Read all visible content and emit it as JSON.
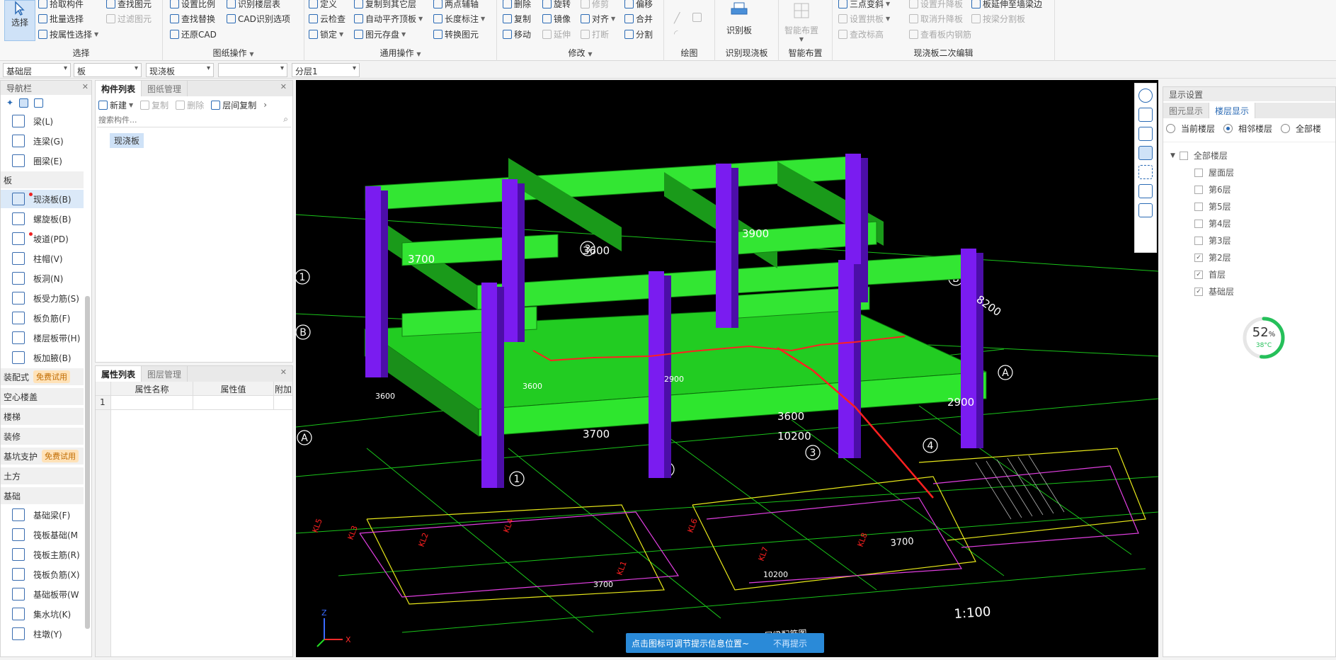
{
  "ribbon": {
    "select": {
      "label": "选择",
      "items": [
        "拾取构件",
        "批量选择",
        "按属性选择"
      ],
      "items2": [
        "查找图元",
        "过滤图元"
      ],
      "title": "选择"
    },
    "drawing_ops": {
      "items": [
        "设置比例",
        "查找替换",
        "还原CAD"
      ],
      "items2": [
        "识别楼层表",
        "CAD识别选项"
      ],
      "title": "图纸操作"
    },
    "general_ops": {
      "col1": [
        "定义",
        "云检查",
        "锁定"
      ],
      "col2": [
        "复制到其它层",
        "自动平齐顶板",
        "图元存盘"
      ],
      "col3": [
        "两点辅轴",
        "长度标注",
        "转换图元"
      ],
      "title": "通用操作"
    },
    "modify": {
      "col1": [
        "删除",
        "复制",
        "移动"
      ],
      "col2": [
        "旋转",
        "镜像",
        "延伸"
      ],
      "col3": [
        "修剪",
        "对齐",
        "打断"
      ],
      "col4": [
        "偏移",
        "合并",
        "分割"
      ],
      "title": "修改"
    },
    "draw": {
      "title": "绘图"
    },
    "identify_slab": {
      "label": "识别板",
      "title": "识别现浇板"
    },
    "smart_layout": {
      "label": "智能布置",
      "title": "智能布置"
    },
    "slab_edit": {
      "col1": [
        "三点变斜",
        "设置拱板",
        "查改标高"
      ],
      "col2": [
        "设置升降板",
        "取消升降板",
        "查看板内钢筋"
      ],
      "col3": [
        "板延伸至墙梁边",
        "按梁分割板"
      ],
      "title": "现浇板二次编辑"
    }
  },
  "dropbar": {
    "floor": "基础层",
    "type": "板",
    "component": "现浇板",
    "blank": "",
    "layer": "分层1"
  },
  "nav": {
    "title": "导航栏",
    "items_top": [
      {
        "label": "梁(L)"
      },
      {
        "label": "连梁(G)"
      },
      {
        "label": "圈梁(E)"
      }
    ],
    "cat_slab": "板",
    "slab_items": [
      {
        "label": "现浇板(B)"
      },
      {
        "label": "螺旋板(B)"
      },
      {
        "label": "坡道(PD)"
      },
      {
        "label": "柱帽(V)"
      },
      {
        "label": "板洞(N)"
      },
      {
        "label": "板受力筋(S)"
      },
      {
        "label": "板负筋(F)"
      },
      {
        "label": "楼层板带(H)"
      },
      {
        "label": "板加腋(B)"
      }
    ],
    "cat_prefab": "装配式",
    "free_trial": "免费试用",
    "cat_hollow": "空心楼盖",
    "cat_stairs": "楼梯",
    "cat_decor": "装修",
    "cat_pit": "基坑支护",
    "cat_earth": "土方",
    "cat_found": "基础",
    "found_items": [
      {
        "label": "基础梁(F)"
      },
      {
        "label": "筏板基础(M"
      },
      {
        "label": "筏板主筋(R)"
      },
      {
        "label": "筏板负筋(X)"
      },
      {
        "label": "基础板带(W"
      },
      {
        "label": "集水坑(K)"
      },
      {
        "label": "柱墩(Y)"
      }
    ]
  },
  "component_list": {
    "tab1": "构件列表",
    "tab2": "图纸管理",
    "new": "新建",
    "copy": "复制",
    "delete": "删除",
    "floor_copy": "层间复制",
    "search_placeholder": "搜索构件...",
    "item": "现浇板"
  },
  "property_list": {
    "tab1": "属性列表",
    "tab2": "图层管理",
    "col_name": "属性名称",
    "col_value": "属性值",
    "col_extra": "附加",
    "row1": "1"
  },
  "viewport": {
    "labels": [
      "3700",
      "3600",
      "3900",
      "3600",
      "2900",
      "3700",
      "8200",
      "2900",
      "3600",
      "10200",
      "3700",
      "3600",
      "10200",
      "3700"
    ],
    "axis": [
      "1",
      "B",
      "3",
      "B",
      "A",
      "A",
      "4",
      "2",
      "1",
      "3"
    ],
    "scale": "1:100",
    "plan_title": "二层梁配筋图"
  },
  "tip": {
    "text": "点击图标可调节提示信息位置~",
    "dismiss": "不再提示"
  },
  "display": {
    "title": "显示设置",
    "tab1": "图元显示",
    "tab2": "楼层显示",
    "radio_current": "当前楼层",
    "radio_adjacent": "相邻楼层",
    "radio_all": "全部楼",
    "floors_root": "全部楼层",
    "floors": [
      {
        "label": "屋面层",
        "checked": false
      },
      {
        "label": "第6层",
        "checked": false
      },
      {
        "label": "第5层",
        "checked": false
      },
      {
        "label": "第4层",
        "checked": false
      },
      {
        "label": "第3层",
        "checked": false
      },
      {
        "label": "第2层",
        "checked": true
      },
      {
        "label": "首层",
        "checked": true
      },
      {
        "label": "基础层",
        "checked": true
      }
    ],
    "gauge_value": "52",
    "gauge_unit": "%",
    "gauge_temp": "38°C",
    "gauge_percent": 52
  }
}
